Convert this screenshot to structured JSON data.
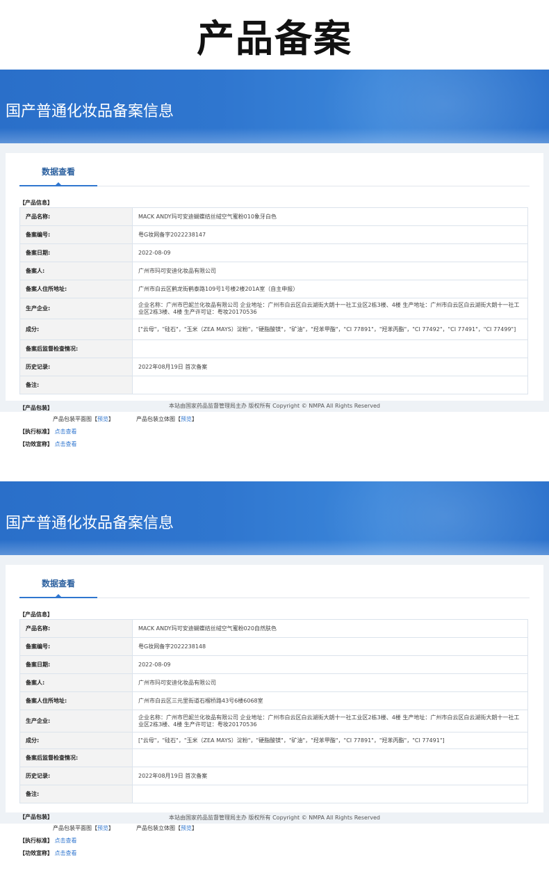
{
  "page": {
    "title": "产品备案"
  },
  "records": [
    {
      "banner_title": "国产普通化妆品备案信息",
      "tab": "数据查看",
      "section_label": "【产品信息】",
      "rows": [
        {
          "key": "产品名称:",
          "value": "MACK ANDY玛可安迪蝴蝶结丝绒空气蜜粉010象牙白色"
        },
        {
          "key": "备案编号:",
          "value": "粤G妆网备字2022238147"
        },
        {
          "key": "备案日期:",
          "value": "2022-08-09"
        },
        {
          "key": "备案人:",
          "value": "广州市玛可安迪化妆品有限公司"
        },
        {
          "key": "备案人住所地址:",
          "value": "广州市白云区鹤龙街鹤泰路109号1号楼2楼201A室（自主申报）"
        },
        {
          "key": "生产企业:",
          "value": "企业名称：广州市巴妮兰化妆品有限公司 企业地址：广州市白云区白云湖街大朗十一社工业区2栋3楼、4楼 生产地址：广州市白云区白云湖街大朗十一社工业区2栋3楼、4楼 生产许可证：粤妆20170536"
        },
        {
          "key": "成分:",
          "value": "[\"云母\"，\"硅石\"，\"玉米（ZEA MAYS）淀粉\"，\"硬脂酸镁\"，\"矿油\"，\"羟苯甲酯\"，\"CI 77891\"，\"羟苯丙酯\"，\"CI 77492\"，\"CI 77491\"，\"CI 77499\"]"
        },
        {
          "key": "备案后监督检查情况:",
          "value": ""
        },
        {
          "key": "历史记录:",
          "value": "2022年08月19日 首次备案"
        },
        {
          "key": "备注:",
          "value": ""
        }
      ],
      "package_label": "【产品包装】",
      "package_flat": "产品包装平面图",
      "package_3d": "产品包装立体图",
      "preview_link": "预览",
      "standard_label": "【执行标准】",
      "efficacy_label": "【功效宣称】",
      "view_link": "点击查看",
      "footer": "本站由国家药品监督管理局主办 版权所有 Copyright © NMPA All Rights Reserved"
    },
    {
      "banner_title": "国产普通化妆品备案信息",
      "tab": "数据查看",
      "section_label": "【产品信息】",
      "rows": [
        {
          "key": "产品名称:",
          "value": "MACK ANDY玛可安迪蝴蝶结丝绒空气蜜粉020自然肤色"
        },
        {
          "key": "备案编号:",
          "value": "粤G妆网备字2022238148"
        },
        {
          "key": "备案日期:",
          "value": "2022-08-09"
        },
        {
          "key": "备案人:",
          "value": "广州市玛可安迪化妆品有限公司"
        },
        {
          "key": "备案人住所地址:",
          "value": "广州市白云区三元里街道石榴桥路43号6楼6068室"
        },
        {
          "key": "生产企业:",
          "value": "企业名称：广州市巴妮兰化妆品有限公司 企业地址：广州市白云区白云湖街大朗十一社工业区2栋3楼、4楼 生产地址：广州市白云区白云湖街大朗十一社工业区2栋3楼、4楼 生产许可证：粤妆20170536"
        },
        {
          "key": "成分:",
          "value": "[\"云母\"，\"硅石\"，\"玉米（ZEA MAYS）淀粉\"，\"硬脂酸镁\"，\"矿油\"，\"羟苯甲酯\"，\"CI 77891\"，\"羟苯丙酯\"，\"CI 77491\"]"
        },
        {
          "key": "备案后监督检查情况:",
          "value": ""
        },
        {
          "key": "历史记录:",
          "value": "2022年08月19日 首次备案"
        },
        {
          "key": "备注:",
          "value": ""
        }
      ],
      "package_label": "【产品包装】",
      "package_flat": "产品包装平面图",
      "package_3d": "产品包装立体图",
      "preview_link": "预览",
      "standard_label": "【执行标准】",
      "efficacy_label": "【功效宣称】",
      "view_link": "点击查看",
      "footer": "本站由国家药品监督管理局主办 版权所有 Copyright © NMPA All Rights Reserved"
    }
  ]
}
